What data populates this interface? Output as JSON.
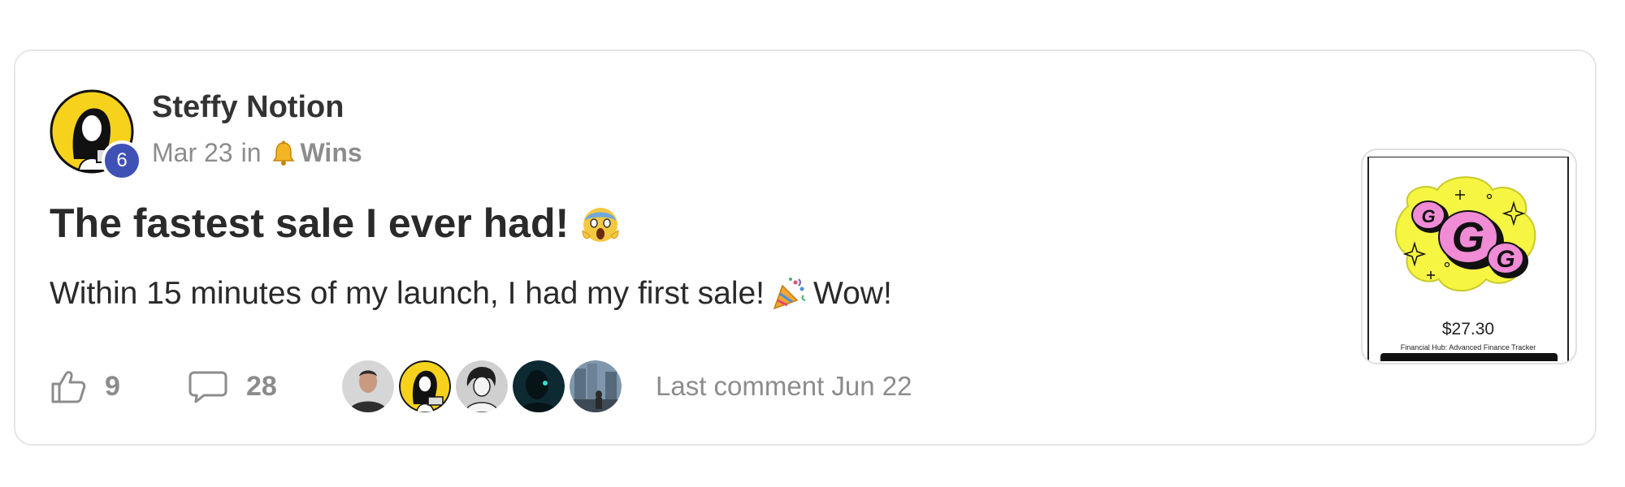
{
  "post": {
    "author": "Steffy Notion",
    "level": "6",
    "date": "Mar 23",
    "in_label": "in",
    "category": "Wins",
    "title": "The fastest sale I ever had!",
    "body_before": "Within 15 minutes of my launch, I had my first sale!",
    "body_after": "Wow!"
  },
  "stats": {
    "likes": "9",
    "comments": "28",
    "last_comment": "Last comment Jun 22"
  },
  "participants": [
    "avatar-man",
    "avatar-steffy",
    "avatar-woman-sketch",
    "avatar-dark-silhouette",
    "avatar-city-photo"
  ],
  "thumbnail": {
    "price": "$27.30",
    "product": "Financial Hub: Advanced Finance Tracker",
    "logo_letters": [
      "G",
      "G",
      "G"
    ]
  },
  "colors": {
    "level_badge": "#3f51b5",
    "muted_text": "#8c8c8c",
    "primary_text": "#2a2a2a",
    "avatar_yellow": "#f7d21c",
    "logo_pink": "#f08bd6",
    "logo_yellow": "#f5f542"
  },
  "icons": {
    "like": "thumbs-up-icon",
    "comment": "comment-bubble-icon",
    "category": "bell-emoji",
    "title_emoji": "screaming-face-emoji",
    "body_emoji": "party-popper-emoji"
  }
}
